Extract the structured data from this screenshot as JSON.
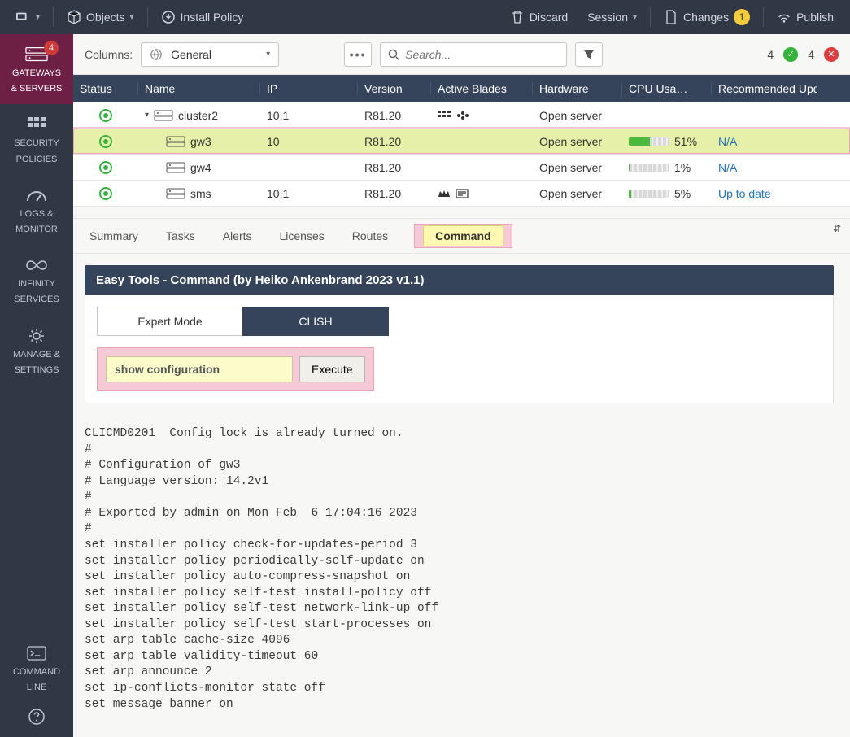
{
  "topbar": {
    "objects_label": "Objects",
    "install_label": "Install Policy",
    "discard_label": "Discard",
    "session_label": "Session",
    "changes_label": "Changes",
    "changes_badge": "1",
    "publish_label": "Publish"
  },
  "leftnav": {
    "gateways_badge": "4",
    "items": [
      {
        "line1": "GATEWAYS",
        "line2": "& SERVERS"
      },
      {
        "line1": "SECURITY",
        "line2": "POLICIES"
      },
      {
        "line1": "LOGS &",
        "line2": "MONITOR"
      },
      {
        "line1": "INFINITY",
        "line2": "SERVICES"
      },
      {
        "line1": "MANAGE &",
        "line2": "SETTINGS"
      }
    ],
    "cmdline": {
      "line1": "COMMAND",
      "line2": "LINE"
    }
  },
  "filterbar": {
    "columns_label": "Columns:",
    "columns_value": "General",
    "search_placeholder": "Search...",
    "ok_count": "4",
    "err_count": "4"
  },
  "table": {
    "headers": [
      "Status",
      "Name",
      "IP",
      "Version",
      "Active Blades",
      "Hardware",
      "CPU Usa…",
      "Recommended Upd"
    ],
    "rows": [
      {
        "name": "cluster2",
        "ip": "10.1",
        "version": "R81.20",
        "hw": "Open server",
        "cpu_pct": "",
        "cpu_fill": 0,
        "rec": "",
        "expandable": true,
        "blades": "grid-net"
      },
      {
        "name": "gw3",
        "ip": "10",
        "version": "R81.20",
        "hw": "Open server",
        "cpu_pct": "51%",
        "cpu_fill": 51,
        "rec": "N/A",
        "selected": true,
        "blades": ""
      },
      {
        "name": "gw4",
        "ip": "",
        "version": "R81.20",
        "hw": "Open server",
        "cpu_pct": "1%",
        "cpu_fill": 1,
        "rec": "N/A",
        "blades": ""
      },
      {
        "name": "sms",
        "ip": "10.1",
        "version": "R81.20",
        "hw": "Open server",
        "cpu_pct": "5%",
        "cpu_fill": 5,
        "rec": "Up to date",
        "blades": "crown"
      }
    ]
  },
  "subtabs": [
    "Summary",
    "Tasks",
    "Alerts",
    "Licenses",
    "Routes",
    "Command"
  ],
  "subtab_active": "Command",
  "command_panel": {
    "title": "Easy Tools - Command (by Heiko Ankenbrand 2023 v1.1)",
    "mode_expert": "Expert Mode",
    "mode_clish": "CLISH",
    "input_value": "show configuration",
    "execute_label": "Execute",
    "output": "CLICMD0201  Config lock is already turned on.\n#\n# Configuration of gw3\n# Language version: 14.2v1\n#\n# Exported by admin on Mon Feb  6 17:04:16 2023\n#\nset installer policy check-for-updates-period 3\nset installer policy periodically-self-update on\nset installer policy auto-compress-snapshot on\nset installer policy self-test install-policy off\nset installer policy self-test network-link-up off\nset installer policy self-test start-processes on\nset arp table cache-size 4096\nset arp table validity-timeout 60\nset arp announce 2\nset ip-conflicts-monitor state off\nset message banner on"
  }
}
